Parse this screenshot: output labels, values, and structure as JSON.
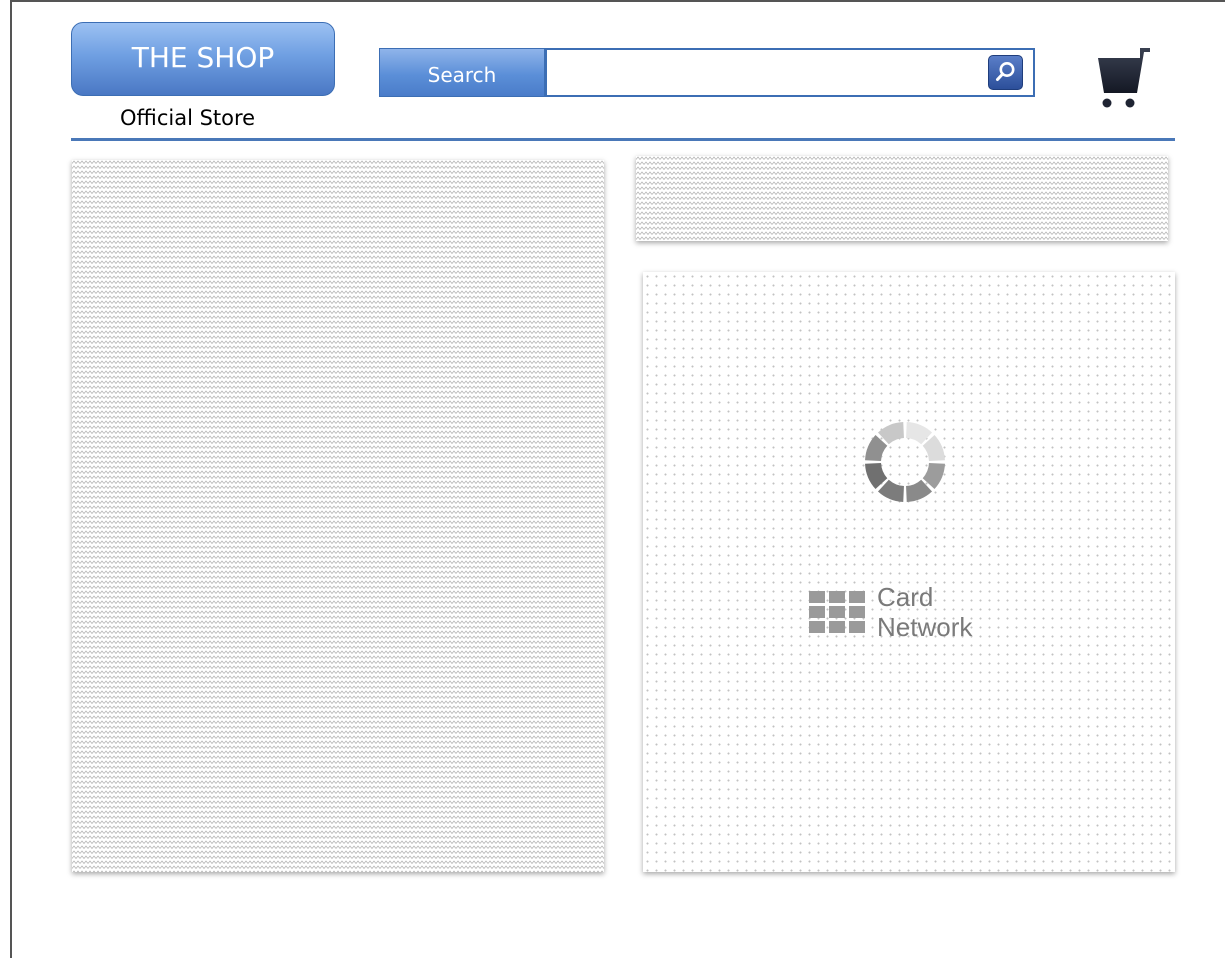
{
  "header": {
    "brand": {
      "title": "THE SHOP",
      "subtitle": "Official Store"
    },
    "search": {
      "label": "Search",
      "value": "",
      "placeholder": "",
      "button_icon": "search-icon"
    },
    "cart_icon": "shopping-cart-icon"
  },
  "content": {
    "main_panel": {
      "state": "placeholder"
    },
    "banner_panel": {
      "state": "placeholder"
    },
    "card_panel": {
      "loading_icon": "loading-spinner-icon",
      "card_network": {
        "line1": "Card",
        "line2": "Network",
        "icon": "card-network-grid-icon"
      }
    }
  },
  "colors": {
    "accent": "#4a78c4",
    "brand_gradient_top": "#9cc1f2",
    "brand_gradient_bottom": "#4a78c4",
    "divider": "#4a78b8",
    "cart": "#1f2433",
    "placeholder_pattern": "#b4b4b4",
    "card_text": "#7a7a7a"
  }
}
